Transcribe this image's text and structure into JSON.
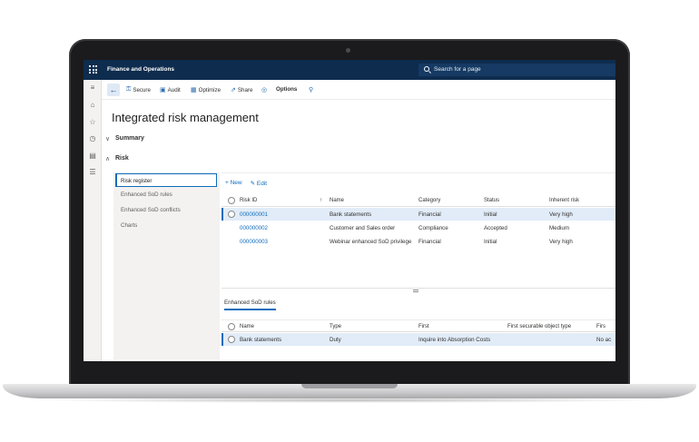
{
  "app": {
    "title": "Finance and Operations",
    "search_placeholder": "Search for a page"
  },
  "actions": {
    "secure": "Secure",
    "audit": "Audit",
    "optimize": "Optimize",
    "share": "Share",
    "options": "Options"
  },
  "page": {
    "title": "Integrated risk management"
  },
  "sections": {
    "summary": "Summary",
    "risk": "Risk"
  },
  "side_list": [
    "Risk register",
    "Enhanced SoD rules",
    "Enhanced SoD conflicts",
    "Charts"
  ],
  "grid_toolbar": {
    "new": "New",
    "edit": "Edit"
  },
  "risk_table": {
    "columns": [
      "Risk ID",
      "Name",
      "Category",
      "Status",
      "Inherent risk"
    ],
    "rows": [
      {
        "id": "000000001",
        "name": "Bank statements",
        "category": "Financial",
        "status": "Initial",
        "inherent": "Very high"
      },
      {
        "id": "000000002",
        "name": "Customer and Sales order",
        "category": "Compliance",
        "status": "Accepted",
        "inherent": "Medium"
      },
      {
        "id": "000000003",
        "name": "Webinar enhanced SoD privilege",
        "category": "Financial",
        "status": "Initial",
        "inherent": "Very high"
      }
    ]
  },
  "lower_tab": "Enhanced SoD rules",
  "rules_table": {
    "columns": [
      "Name",
      "Type",
      "First",
      "First securable object type",
      "Firs"
    ],
    "rows": [
      {
        "name": "Bank statements",
        "type": "Duty",
        "first": "Inquire into Absorption Costs",
        "first_type": "",
        "firs": "No ac"
      }
    ]
  },
  "colors": {
    "topbar": "#0e2c4e",
    "accent": "#0f6cbd",
    "selected_row": "#e1ecf8"
  }
}
